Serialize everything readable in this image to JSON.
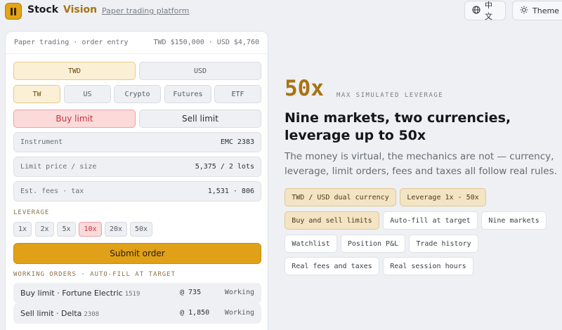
{
  "header": {
    "brand_primary": "Stock",
    "brand_secondary": "Vision",
    "tagline": "Paper trading platform",
    "lang_button": "中文",
    "theme_button": "Theme"
  },
  "panel": {
    "title": "Paper trading · order entry",
    "balances": "TWD $150,000 · USD $4,760",
    "currencies": [
      "TWD",
      "USD"
    ],
    "markets": [
      "TW",
      "US",
      "Crypto",
      "Futures",
      "ETF"
    ],
    "sides": [
      "Buy limit",
      "Sell limit"
    ],
    "fields": [
      {
        "label": "Instrument",
        "value": "EMC 2383"
      },
      {
        "label": "Limit price / size",
        "value": "5,375 / 2 lots"
      },
      {
        "label": "Est. fees · tax",
        "value": "1,531 · 806"
      }
    ],
    "leverage_title": "LEVERAGE",
    "leverage": [
      "1x",
      "2x",
      "5x",
      "10x",
      "20x",
      "50x"
    ],
    "leverage_selected": "10x",
    "submit_label": "Submit order",
    "orders_title": "WORKING ORDERS · AUTO-FILL AT TARGET",
    "orders": [
      {
        "name": "Buy limit · Fortune Electric",
        "code": "1519",
        "price": "@ 735",
        "status": "Working"
      },
      {
        "name": "Sell limit · Delta",
        "code": "2308",
        "price": "@ 1,850",
        "status": "Working"
      }
    ]
  },
  "hero": {
    "big_number": "50x",
    "big_caption": "MAX SIMULATED LEVERAGE",
    "heading_line1": "Nine markets, two currencies,",
    "heading_line2": "leverage up to 50x",
    "description": "The money is virtual, the mechanics are not — currency, leverage, limit orders, fees and taxes all follow real rules.",
    "tags": [
      "TWD / USD dual currency",
      "Leverage 1x - 50x",
      "Buy and sell limits",
      "Auto-fill at target",
      "Nine markets",
      "Watchlist",
      "Position P&L",
      "Trade history",
      "Real fees and taxes",
      "Real session hours"
    ]
  },
  "colors": {
    "accent_gold": "#e0a017",
    "brand_gold": "#a87312",
    "buy_red": "#c0353f"
  }
}
